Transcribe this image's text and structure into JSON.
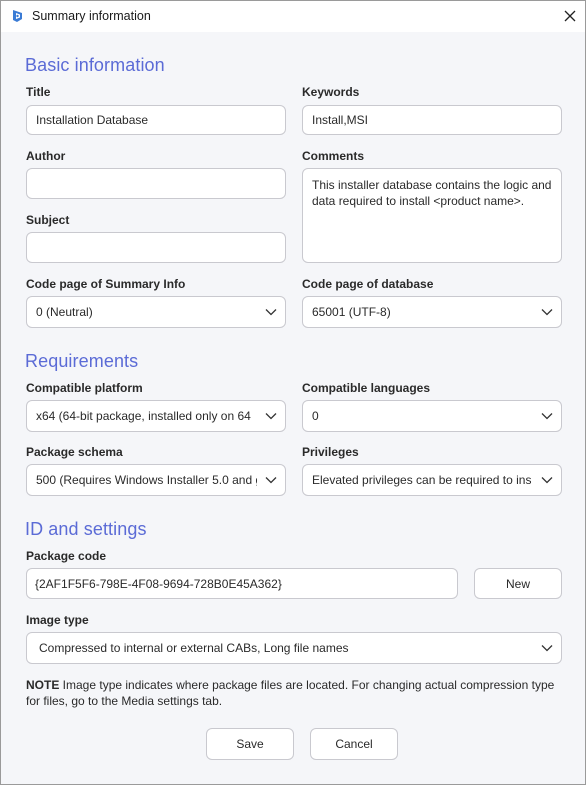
{
  "window": {
    "title": "Summary information"
  },
  "basic": {
    "section_title": "Basic information",
    "title_label": "Title",
    "title_value": "Installation Database",
    "keywords_label": "Keywords",
    "keywords_value": "Install,MSI",
    "author_label": "Author",
    "author_value": "",
    "comments_label": "Comments",
    "comments_value": "This installer database contains the logic and data required to install <product name>.",
    "subject_label": "Subject",
    "subject_value": "",
    "codepage_summary_label": "Code page of Summary Info",
    "codepage_summary_value": "0 (Neutral)",
    "codepage_db_label": "Code page of database",
    "codepage_db_value": "65001 (UTF-8)"
  },
  "requirements": {
    "section_title": "Requirements",
    "platform_label": "Compatible platform",
    "platform_value": "x64 (64-bit package, installed only on 64",
    "languages_label": "Compatible languages",
    "languages_value": "0",
    "schema_label": "Package schema",
    "schema_value": "500 (Requires Windows Installer 5.0 and g",
    "privileges_label": "Privileges",
    "privileges_value": "Elevated privileges can be required to ins"
  },
  "id_settings": {
    "section_title": "ID and settings",
    "package_code_label": "Package code",
    "package_code_value": "{2AF1F5F6-798E-4F08-9694-728B0E45A362}",
    "new_button": "New",
    "image_type_label": "Image type",
    "image_type_value": "Compressed to internal or external CABs, Long file names",
    "note_prefix": "NOTE",
    "note_text": " Image type indicates where package files are located. For changing actual compression type for files, go to the Media settings tab."
  },
  "footer": {
    "save_label": "Save",
    "cancel_label": "Cancel"
  },
  "colors": {
    "section_title": "#5b6bd6",
    "app_icon": "#3a7bd5"
  }
}
